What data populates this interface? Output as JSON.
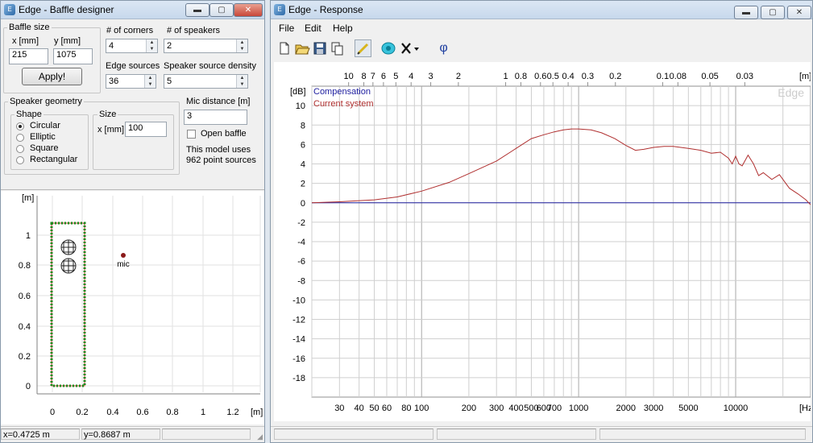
{
  "baffle_window": {
    "title": "Edge - Baffle designer",
    "buttons": {
      "minimize": "▬",
      "maximize": "▢",
      "close": "✕"
    },
    "baffle_size": {
      "label": "Baffle size",
      "x_label": "x [mm]",
      "y_label": "y [mm]",
      "x_value": "215",
      "y_value": "1075",
      "apply_label": "Apply!"
    },
    "corners": {
      "label": "# of corners",
      "value": "4"
    },
    "speakers": {
      "label": "# of speakers",
      "value": "2"
    },
    "edge_sources": {
      "label": "Edge sources",
      "value": "36"
    },
    "speaker_density": {
      "label": "Speaker source density",
      "value": "5"
    },
    "geometry": {
      "label": "Speaker geometry",
      "shape_label": "Shape",
      "shapes": [
        "Circular",
        "Elliptic",
        "Square",
        "Rectangular"
      ],
      "selected": "Circular",
      "size_label": "Size",
      "size_x_label": "x [mm]",
      "size_value": "100"
    },
    "mic": {
      "label": "Mic distance [m]",
      "value": "3",
      "open_baffle_label": "Open baffle",
      "model_line1": "This model uses",
      "model_line2": "962 point sources"
    },
    "plot": {
      "y_unit": "[m]",
      "x_unit": "[m]",
      "y_ticks": [
        "1",
        "0.8",
        "0.6",
        "0.4",
        "0.2",
        "0"
      ],
      "x_ticks": [
        "0",
        "0.2",
        "0.4",
        "0.6",
        "0.8",
        "1",
        "1.2"
      ],
      "mic_label": "mic"
    },
    "status": {
      "x": "x=0.4725 m",
      "y": "y=0.8687 m"
    }
  },
  "response_window": {
    "title": "Edge - Response",
    "buttons": {
      "minimize": "▬",
      "maximize": "▢",
      "close": "✕"
    },
    "menu": [
      "File",
      "Edit",
      "Help"
    ],
    "toolbar_phi": "φ",
    "watermark": "Edge"
  },
  "chart_data": {
    "type": "line",
    "title": "",
    "ylabel": "[dB]",
    "xlabel": "[Hz]",
    "top_axis_label": "[m]",
    "x_scale": "log",
    "xlim": [
      20,
      30000
    ],
    "ylim": [
      -20,
      12
    ],
    "grid": true,
    "legend_position": "top-left",
    "x_ticks": [
      30,
      40,
      50,
      60,
      80,
      100,
      200,
      300,
      400,
      500,
      600,
      700,
      1000,
      2000,
      3000,
      5000,
      10000
    ],
    "x_tick_labels": [
      "30",
      "40",
      "50",
      "60",
      "80",
      "100",
      "200",
      "300",
      "400",
      "500",
      "600",
      "700",
      "1000",
      "2000",
      "3000",
      "5000",
      "10000"
    ],
    "y_ticks": [
      10,
      8,
      6,
      4,
      2,
      0,
      -2,
      -4,
      -6,
      -8,
      -10,
      -12,
      -14,
      -16,
      -18
    ],
    "top_ticks": [
      "10",
      "8",
      "7",
      "6",
      "5",
      "4",
      "3",
      "2",
      "1",
      "0.8",
      "0.6",
      "0.5",
      "0.4",
      "0.3",
      "0.2",
      "0.1",
      "0.08",
      "0.05",
      "0.03"
    ],
    "series": [
      {
        "name": "Compensation",
        "color": "#2020a0",
        "x": [
          20,
          30000
        ],
        "y": [
          0,
          0
        ]
      },
      {
        "name": "Current system",
        "color": "#b03030",
        "x": [
          20,
          30,
          50,
          70,
          100,
          150,
          200,
          300,
          400,
          500,
          600,
          700,
          800,
          900,
          1000,
          1200,
          1400,
          1700,
          2000,
          2300,
          2600,
          3000,
          3500,
          4000,
          5000,
          6000,
          7000,
          8000,
          9000,
          9500,
          10000,
          10500,
          11000,
          12000,
          13000,
          14000,
          15000,
          17000,
          19000,
          22000,
          25000,
          28000,
          30000
        ],
        "y": [
          0,
          0.1,
          0.3,
          0.6,
          1.2,
          2.1,
          3.0,
          4.3,
          5.6,
          6.6,
          7.0,
          7.3,
          7.5,
          7.6,
          7.6,
          7.5,
          7.2,
          6.6,
          5.9,
          5.4,
          5.5,
          5.7,
          5.8,
          5.8,
          5.6,
          5.4,
          5.1,
          5.2,
          4.6,
          4.0,
          4.8,
          4.0,
          3.8,
          4.9,
          4.0,
          2.8,
          3.1,
          2.4,
          2.9,
          1.5,
          0.9,
          0.3,
          -0.2
        ]
      }
    ]
  }
}
